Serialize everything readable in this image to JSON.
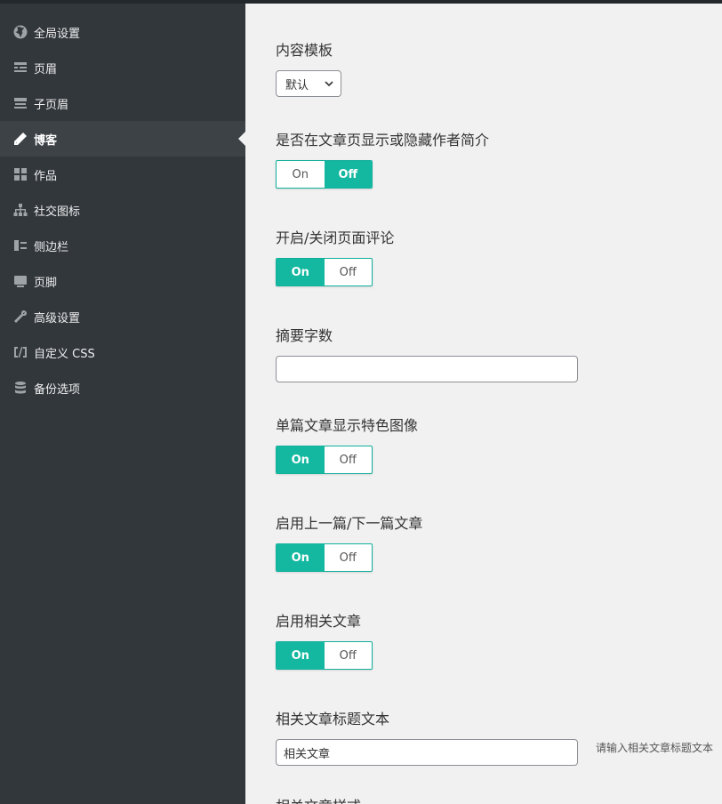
{
  "sidebar": {
    "items": [
      {
        "label": "全局设置",
        "icon": "globe-icon"
      },
      {
        "label": "页眉",
        "icon": "header-icon"
      },
      {
        "label": "子页眉",
        "icon": "subheader-icon"
      },
      {
        "label": "博客",
        "icon": "pencil-icon",
        "active": true
      },
      {
        "label": "作品",
        "icon": "grid-icon"
      },
      {
        "label": "社交图标",
        "icon": "sitemap-icon"
      },
      {
        "label": "侧边栏",
        "icon": "sidebar-icon"
      },
      {
        "label": "页脚",
        "icon": "footer-icon"
      },
      {
        "label": "高级设置",
        "icon": "wrench-icon"
      },
      {
        "label": "自定义 CSS",
        "icon": "code-icon"
      },
      {
        "label": "备份选项",
        "icon": "database-icon"
      }
    ]
  },
  "fields": {
    "content_template": {
      "label": "内容模板",
      "value": "默认"
    },
    "author_bio": {
      "label": "是否在文章页显示或隐藏作者简介",
      "on": "On",
      "off": "Off",
      "selected": "Off"
    },
    "page_comments": {
      "label": "开启/关闭页面评论",
      "on": "On",
      "off": "Off",
      "selected": "On"
    },
    "excerpt_length": {
      "label": "摘要字数",
      "value": ""
    },
    "featured_image": {
      "label": "单篇文章显示特色图像",
      "on": "On",
      "off": "Off",
      "selected": "On"
    },
    "prev_next": {
      "label": "启用上一篇/下一篇文章",
      "on": "On",
      "off": "Off",
      "selected": "On"
    },
    "related_posts": {
      "label": "启用相关文章",
      "on": "On",
      "off": "Off",
      "selected": "On"
    },
    "related_title": {
      "label": "相关文章标题文本",
      "value": "相关文章",
      "help": "请输入相关文章标题文本"
    },
    "related_style": {
      "label": "相关文章样式"
    }
  },
  "colors": {
    "accent": "#14b8a0",
    "sidebar_bg": "#32373c",
    "active_bg": "#3d4247"
  }
}
